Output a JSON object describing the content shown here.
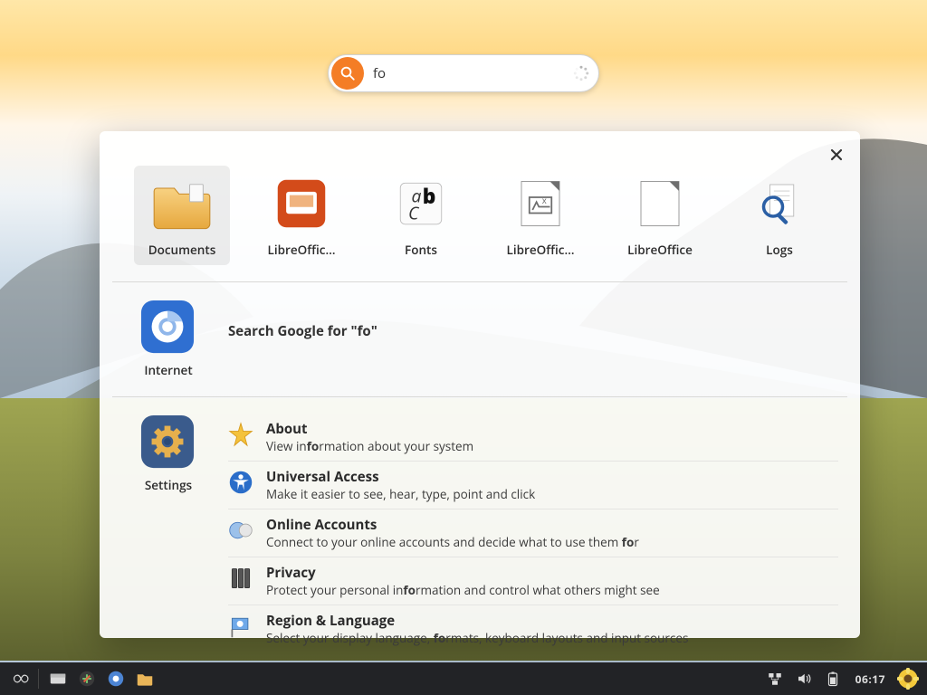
{
  "search": {
    "value": "fo",
    "placeholder": "",
    "loading": true
  },
  "apps": [
    {
      "label": "Documents",
      "icon": "folder-documents-icon",
      "selected": true
    },
    {
      "label": "LibreOffic…",
      "icon": "libreoffice-impress-icon",
      "selected": false
    },
    {
      "label": "Fonts",
      "icon": "fonts-icon",
      "selected": false
    },
    {
      "label": "LibreOffic…",
      "icon": "libreoffice-math-icon",
      "selected": false
    },
    {
      "label": "LibreOffice",
      "icon": "libreoffice-start-icon",
      "selected": false
    },
    {
      "label": "Logs",
      "icon": "logs-icon",
      "selected": false
    }
  ],
  "internet": {
    "side_label": "Internet",
    "google_text": "Search Google for \"fo\""
  },
  "settings": {
    "side_label": "Settings",
    "items": [
      {
        "icon": "about-icon",
        "title": "About",
        "sub_pre": "View in",
        "sub_hl": "fo",
        "sub_post": "rmation about your system"
      },
      {
        "icon": "universal-access-icon",
        "title": "Universal Access",
        "sub_pre": "Make it easier to see, hear, type, point and click",
        "sub_hl": "",
        "sub_post": ""
      },
      {
        "icon": "online-accounts-icon",
        "title": "Online Accounts",
        "sub_pre": "Connect to your online accounts and decide what to use them ",
        "sub_hl": "fo",
        "sub_post": "r"
      },
      {
        "icon": "privacy-icon",
        "title": "Privacy",
        "sub_pre": "Protect your personal in",
        "sub_hl": "fo",
        "sub_post": "rmation and control what others might see"
      },
      {
        "icon": "region-language-icon",
        "title": "Region & Language",
        "sub_pre": "Select your display language, ",
        "sub_hl": "fo",
        "sub_post": "rmats, keyboard layouts and input sources"
      }
    ]
  },
  "taskbar": {
    "clock": "06:17"
  }
}
